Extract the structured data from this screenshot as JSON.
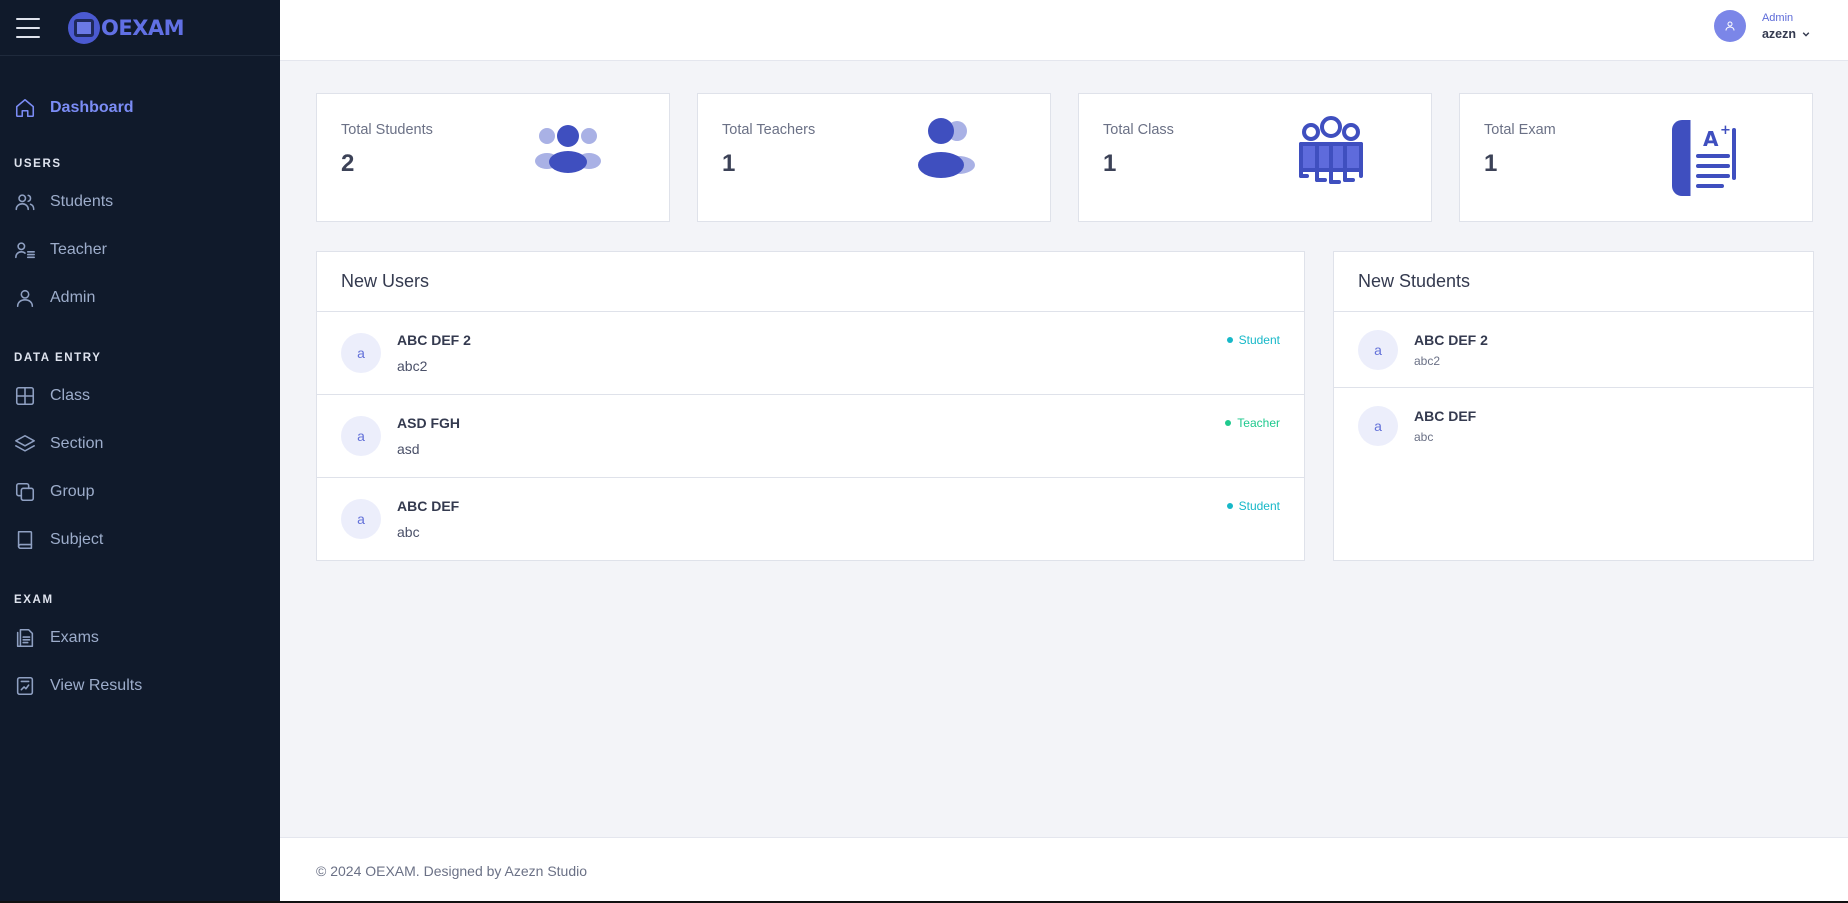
{
  "brand": {
    "logo_text": "OEXAM"
  },
  "sidebar": {
    "dashboard": "Dashboard",
    "sections": [
      {
        "title": "USERS",
        "items": [
          "Students",
          "Teacher",
          "Admin"
        ]
      },
      {
        "title": "DATA ENTRY",
        "items": [
          "Class",
          "Section",
          "Group",
          "Subject"
        ]
      },
      {
        "title": "EXAM",
        "items": [
          "Exams",
          "View Results"
        ]
      }
    ]
  },
  "header": {
    "user_role": "Admin",
    "user_name": "azezn"
  },
  "stats": [
    {
      "label": "Total Students",
      "value": "2"
    },
    {
      "label": "Total Teachers",
      "value": "1"
    },
    {
      "label": "Total Class",
      "value": "1"
    },
    {
      "label": "Total Exam",
      "value": "1"
    }
  ],
  "new_users": {
    "title": "New Users",
    "rows": [
      {
        "initial": "a",
        "name": "ABC DEF 2",
        "handle": "abc2",
        "role": "Student"
      },
      {
        "initial": "a",
        "name": "ASD FGH",
        "handle": "asd",
        "role": "Teacher"
      },
      {
        "initial": "a",
        "name": "ABC DEF",
        "handle": "abc",
        "role": "Student"
      }
    ]
  },
  "new_students": {
    "title": "New Students",
    "rows": [
      {
        "initial": "a",
        "name": "ABC DEF 2",
        "handle": "abc2"
      },
      {
        "initial": "a",
        "name": "ABC DEF",
        "handle": "abc"
      }
    ]
  },
  "colors": {
    "student_badge": "#17b8c8",
    "teacher_badge": "#1fc98e",
    "accent": "#4b5ad1"
  },
  "footer": {
    "text": "© 2024 OEXAM. Designed by Azezn Studio"
  }
}
